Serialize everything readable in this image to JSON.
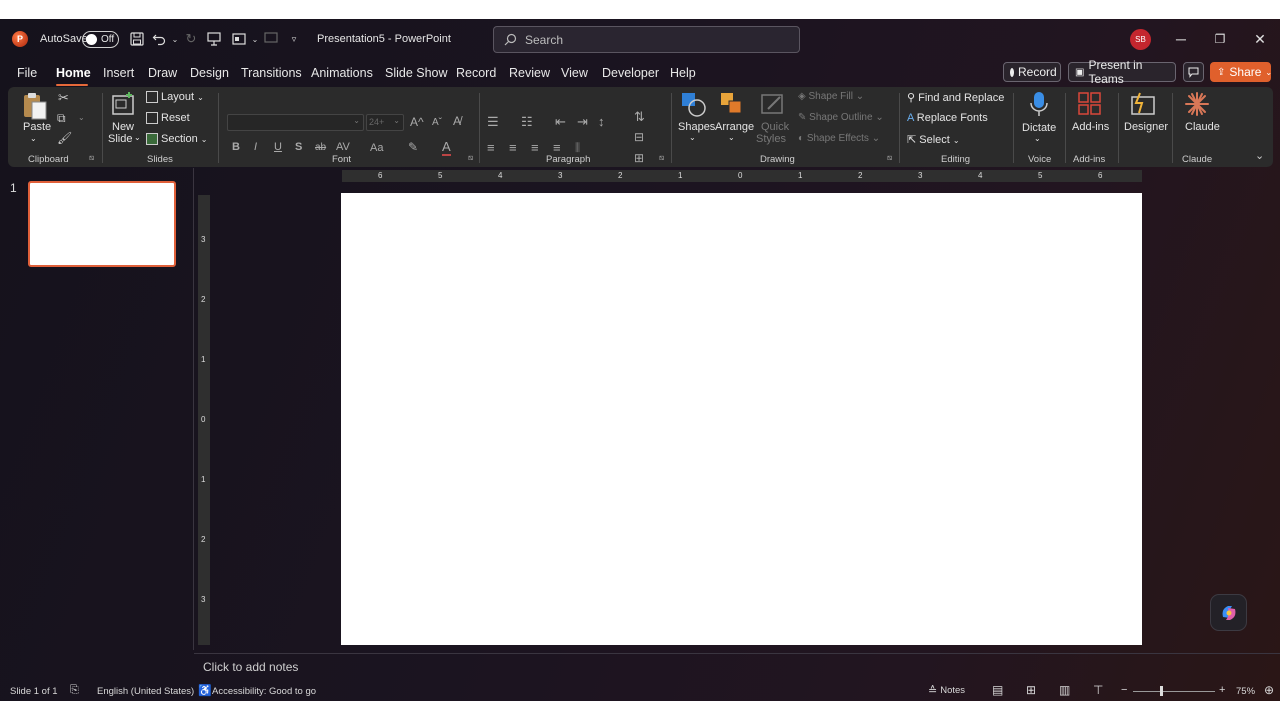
{
  "titlebar": {
    "autosave_label": "AutoSave",
    "autosave_state": "Off",
    "doc_title": "Presentation5 - PowerPoint",
    "search_placeholder": "Search",
    "avatar_initials": "SB"
  },
  "tabs": [
    "File",
    "Home",
    "Insert",
    "Draw",
    "Design",
    "Transitions",
    "Animations",
    "Slide Show",
    "Record",
    "Review",
    "View",
    "Developer",
    "Help"
  ],
  "active_tab": "Home",
  "top_buttons": {
    "record": "Record",
    "present_teams": "Present in Teams",
    "share": "Share"
  },
  "ribbon": {
    "clipboard": {
      "paste": "Paste",
      "group": "Clipboard"
    },
    "slides": {
      "new_slide_1": "New",
      "new_slide_2": "Slide",
      "layout": "Layout",
      "reset": "Reset",
      "section": "Section",
      "group": "Slides"
    },
    "font": {
      "size": "24+",
      "bold": "B",
      "italic": "I",
      "underline": "U",
      "shadow": "S",
      "strike": "ab",
      "spacing": "AV",
      "case": "Aa",
      "grow": "A",
      "shrink": "A",
      "group": "Font"
    },
    "paragraph": {
      "group": "Paragraph"
    },
    "drawing": {
      "shapes": "Shapes",
      "arrange": "Arrange",
      "quick_styles_1": "Quick",
      "quick_styles_2": "Styles",
      "shape_fill": "Shape Fill",
      "shape_outline": "Shape Outline",
      "shape_effects": "Shape Effects",
      "group": "Drawing"
    },
    "editing": {
      "find_replace": "Find and Replace",
      "replace_fonts": "Replace Fonts",
      "select": "Select",
      "group": "Editing"
    },
    "voice": {
      "dictate": "Dictate",
      "group": "Voice"
    },
    "addins": {
      "addins": "Add-ins",
      "group": "Add-ins"
    },
    "designer": {
      "designer": "Designer"
    },
    "claude": {
      "claude": "Claude",
      "group": "Claude"
    }
  },
  "slide_pane": {
    "slide_number": "1"
  },
  "ruler": {
    "h_labels": [
      "6",
      "5",
      "4",
      "3",
      "2",
      "1",
      "0",
      "1",
      "2",
      "3",
      "4",
      "5",
      "6"
    ],
    "v_labels": [
      "3",
      "2",
      "1",
      "0",
      "1",
      "2",
      "3"
    ]
  },
  "notes_placeholder": "Click to add notes",
  "statusbar": {
    "slide_count": "Slide 1 of 1",
    "language": "English (United States)",
    "accessibility": "Accessibility: Good to go",
    "notes": "Notes",
    "zoom": "75%"
  }
}
